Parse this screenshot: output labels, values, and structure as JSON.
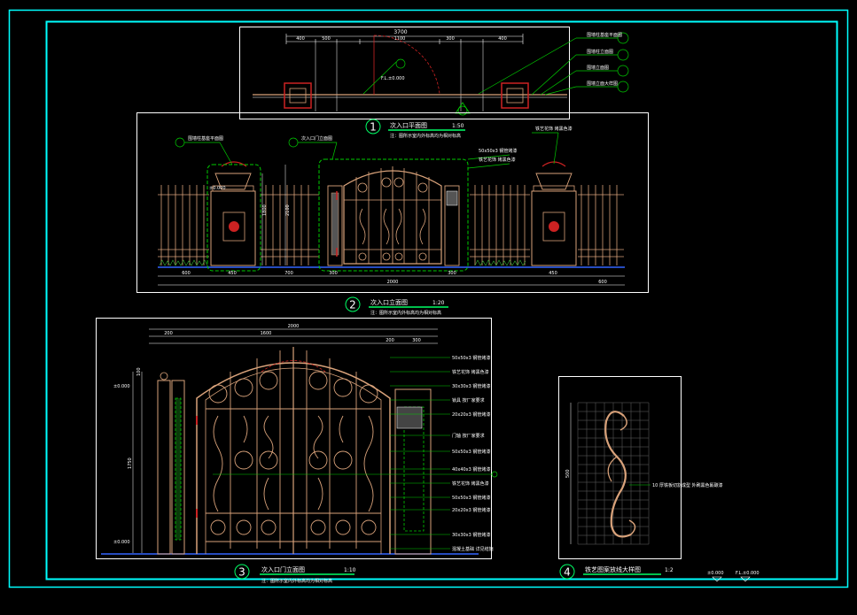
{
  "drawing": {
    "colors": {
      "background": "#000000",
      "outer_border": "#00ffff",
      "frame": "#ffffff",
      "gate": "#d9a27a",
      "annotation": "#00cc00",
      "accent": "#cc2222",
      "dimension": "#00ff66"
    },
    "views": [
      {
        "number": "1",
        "title": "次入口平面图",
        "scale": "1:50",
        "note": "注：图所示室内外标高均为相对标高"
      },
      {
        "number": "2",
        "title": "次入口立面图",
        "scale": "1:20",
        "note": "注：图所示室内外标高均为相对标高"
      },
      {
        "number": "3",
        "title": "次入口门立面图",
        "scale": "1:10",
        "note": "注：图所示室内外标高均为相对标高"
      },
      {
        "number": "4",
        "title": "铁艺图案放线大样图",
        "scale": "1:2",
        "note": ""
      }
    ],
    "elevation_marks": [
      "±0.000",
      "±0.000",
      "±0.000",
      "±0.000",
      "F.L.±0.000"
    ],
    "view1_dims": [
      "3700",
      "1800",
      "400",
      "500",
      "1100",
      "300",
      "400"
    ],
    "view2_dims": [
      "600",
      "450",
      "700",
      "300",
      "2000",
      "300",
      "450",
      "600"
    ],
    "view3_dims": [
      "2000",
      "200",
      "1600",
      "200",
      "300",
      "1750",
      "100"
    ],
    "view2_height_dims": [
      "1800",
      "2100"
    ],
    "callouts_view3": [
      "50x50x3 钢管烤漆",
      "铁艺花饰 烤黑色漆",
      "30x30x3 钢管烤漆",
      "锁具 按厂家要求",
      "20x20x3 钢管烤漆",
      "门轴 按厂家要求",
      "50x50x3 钢管烤漆",
      "40x40x3 钢管烤漆",
      "铁艺花饰 烤黑色漆",
      "50x50x3 钢管烤漆",
      "20x20x3 钢管烤漆",
      "30x30x3 钢管烤漆",
      "混凝土基础 详见结施"
    ],
    "callouts_view1": [
      "围墙柱基座平面图",
      "围墙柱立面图",
      "围墙立面图",
      "围墙立面大样图"
    ],
    "callouts_view2": [
      "围墙柱基座平面图",
      "次入口门立面图"
    ],
    "callouts_view2_right": [
      "50x50x3 钢管烤漆",
      "铁艺花饰 烤黑色漆"
    ],
    "view4_callout": "10 厚铁板切割成型 外刷黑色氟碳漆",
    "view4_grid_dim": "500",
    "bottom_right_labels": [
      "±0.000",
      "F.L.±0.000"
    ]
  }
}
